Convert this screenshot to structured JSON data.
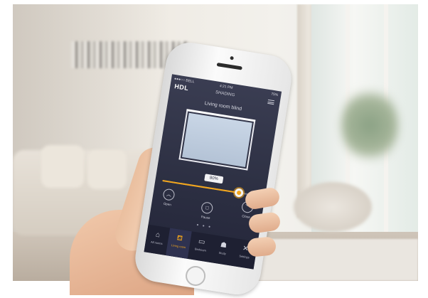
{
  "app": {
    "status_bar": {
      "carrier": "●●●○○ BELL",
      "time": "4:21 PM",
      "battery": "75%"
    },
    "header": {
      "logo": "HDL",
      "title": "SHADING"
    },
    "device": {
      "title": "Living room blind",
      "position_percent": 80,
      "position_label": "80%"
    },
    "controls": [
      {
        "label": "Open",
        "icon": "chevron-up-icon"
      },
      {
        "label": "Pause",
        "icon": "stop-icon"
      },
      {
        "label": "Close",
        "icon": "chevron-down-icon"
      }
    ],
    "page_dots": "● ● ●",
    "tabs": [
      {
        "label": "All rooms",
        "icon": "home-icon",
        "glyph": "⌂",
        "active": false
      },
      {
        "label": "Living room",
        "icon": "sofa-icon",
        "glyph": "⛾",
        "active": true
      },
      {
        "label": "Bedroom",
        "icon": "bed-icon",
        "glyph": "▭",
        "active": false
      },
      {
        "label": "Study",
        "icon": "lamp-icon",
        "glyph": "☗",
        "active": false
      },
      {
        "label": "Settings",
        "icon": "tools-icon",
        "glyph": "✕",
        "active": false
      }
    ],
    "colors": {
      "accent": "#f2a51b",
      "background": "#2c2f42",
      "tabbar": "#1e2032"
    }
  }
}
